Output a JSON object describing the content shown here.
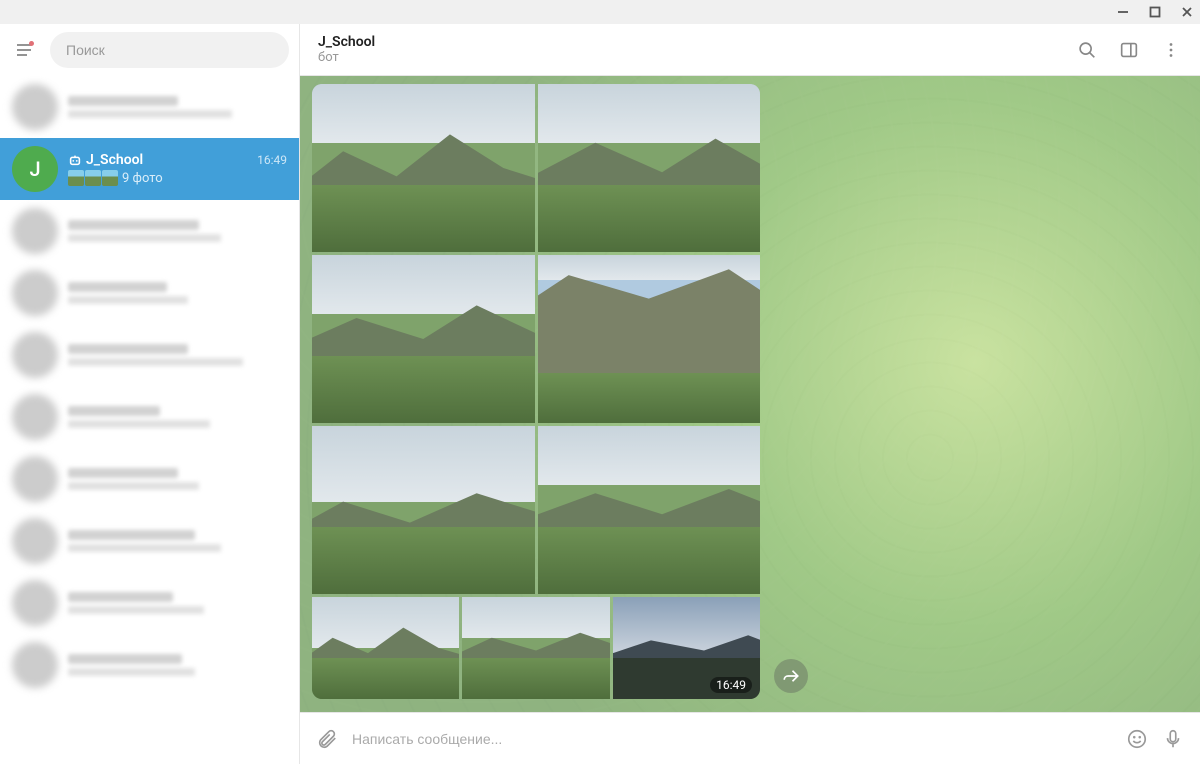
{
  "search": {
    "placeholder": "Поиск"
  },
  "active_chat": {
    "name": "J_School",
    "avatar_letter": "J",
    "time": "16:49",
    "preview_text": "9 фото"
  },
  "header": {
    "title": "J_School",
    "subtitle": "бот"
  },
  "message": {
    "photo_count": 9,
    "timestamp": "16:49"
  },
  "composer": {
    "placeholder": "Написать сообщение..."
  }
}
